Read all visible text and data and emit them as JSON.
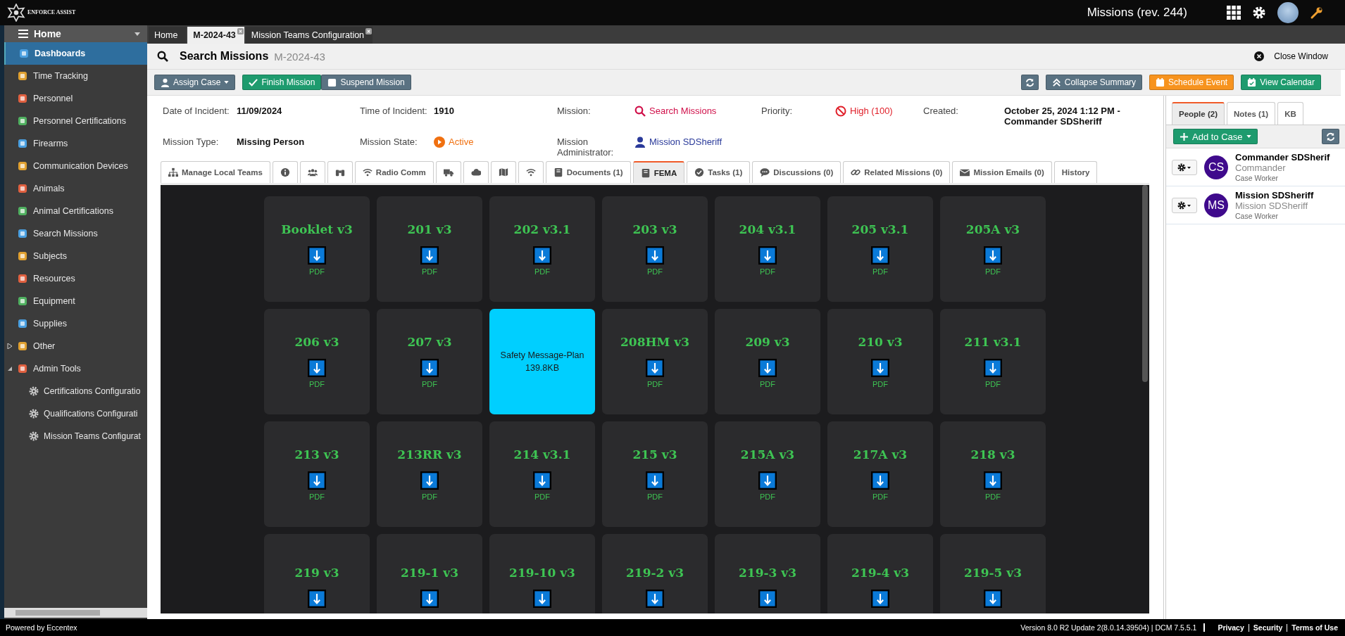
{
  "top_bar": {
    "logo_text": "ENFORCE ASSIST",
    "title": "Missions (rev. 244)"
  },
  "sidebar": {
    "header": "Home",
    "items": [
      {
        "label": "Dashboards",
        "selected": true
      },
      {
        "label": "Time Tracking",
        "selected": false
      },
      {
        "label": "Personnel",
        "selected": false
      },
      {
        "label": "Personnel Certifications",
        "selected": false
      },
      {
        "label": "Firearms",
        "selected": false
      },
      {
        "label": "Communication Devices",
        "selected": false
      },
      {
        "label": "Animals",
        "selected": false
      },
      {
        "label": "Animal Certifications",
        "selected": false
      },
      {
        "label": "Search Missions",
        "selected": false
      },
      {
        "label": "Subjects",
        "selected": false
      },
      {
        "label": "Resources",
        "selected": false
      },
      {
        "label": "Equipment",
        "selected": false
      },
      {
        "label": "Supplies",
        "selected": false
      },
      {
        "label": "Other",
        "selected": false,
        "expanded": false
      },
      {
        "label": "Admin Tools",
        "selected": false,
        "expanded": true,
        "children": [
          {
            "label": "Certifications Configuratio",
            "selected": false
          },
          {
            "label": "Qualifications Configurati",
            "selected": false
          },
          {
            "label": "Mission Teams Configurat",
            "selected": false
          }
        ]
      }
    ]
  },
  "doc_tabs": [
    {
      "label": "Home",
      "selected": false,
      "closable": false
    },
    {
      "label": "M-2024-43",
      "selected": true,
      "closable": true
    },
    {
      "label": "Mission Teams Configuration",
      "selected": false,
      "closable": true
    }
  ],
  "header": {
    "title": "Search Missions",
    "subtitle": "M-2024-43",
    "close": "Close Window"
  },
  "toolbar": {
    "left": [
      {
        "label": "Assign Case",
        "kind": "dropdown"
      },
      {
        "label": "Finish Mission",
        "kind": "finish"
      },
      {
        "label": "Suspend Mission",
        "kind": "suspend"
      }
    ],
    "right": [
      {
        "kind": "refresh"
      },
      {
        "label": "Collapse Summary",
        "kind": "collapse"
      },
      {
        "label": "Schedule Event",
        "kind": "schedule"
      },
      {
        "label": "View Calendar",
        "kind": "calendar"
      }
    ]
  },
  "summary": [
    {
      "label": "Date of Incident:",
      "value": "11/09/2024",
      "kind": "text"
    },
    {
      "label": "Time of Incident:",
      "value": "1910",
      "kind": "text"
    },
    {
      "label": "Mission:",
      "value": "Search Missions",
      "kind": "link"
    },
    {
      "label": "Priority:",
      "value": "High (100)",
      "kind": "priority"
    },
    {
      "label": "Created:",
      "value": "October 25, 2024 1:12 PM - Commander SDSheriff",
      "kind": "text"
    },
    {
      "label": "Mission Type:",
      "value": "Missing Person",
      "kind": "text"
    },
    {
      "label": "Mission State:",
      "value": "Active",
      "kind": "state"
    },
    {
      "label": "Mission Administrator:",
      "value": "Mission SDSheriff",
      "kind": "person"
    }
  ],
  "detail_tabs": [
    {
      "label": "Manage Local Teams",
      "selected": false
    },
    {
      "selected": false
    },
    {
      "selected": false
    },
    {
      "selected": false
    },
    {
      "label": "Radio Comm",
      "selected": false
    },
    {
      "selected": false
    },
    {
      "selected": false
    },
    {
      "selected": false
    },
    {
      "selected": false
    },
    {
      "label": "Documents (1)",
      "selected": false
    },
    {
      "label": "FEMA",
      "selected": true
    },
    {
      "label": "Tasks (1)",
      "selected": false
    },
    {
      "label": "Discussions (0)",
      "selected": false
    },
    {
      "label": "Related Missions (0)",
      "selected": false
    },
    {
      "label": "Mission Emails (0)",
      "selected": false
    },
    {
      "label": "History",
      "selected": false
    }
  ],
  "forms": [
    {
      "title": "Booklet v3",
      "file_type": "PDF",
      "kind": "pdf"
    },
    {
      "title": "201 v3",
      "file_type": "PDF",
      "kind": "pdf"
    },
    {
      "title": "202 v3.1",
      "file_type": "PDF",
      "kind": "pdf"
    },
    {
      "title": "203 v3",
      "file_type": "PDF",
      "kind": "pdf"
    },
    {
      "title": "204 v3.1",
      "file_type": "PDF",
      "kind": "pdf"
    },
    {
      "title": "205 v3.1",
      "file_type": "PDF",
      "kind": "pdf"
    },
    {
      "title": "205A v3",
      "file_type": "PDF",
      "kind": "pdf"
    },
    {
      "title": "206 v3",
      "file_type": "PDF",
      "kind": "pdf"
    },
    {
      "title": "207 v3",
      "file_type": "PDF",
      "kind": "pdf"
    },
    {
      "title": "Safety Message-Plan",
      "size": "139.8KB",
      "kind": "info"
    },
    {
      "title": "208HM v3",
      "file_type": "PDF",
      "kind": "pdf"
    },
    {
      "title": "209 v3",
      "file_type": "PDF",
      "kind": "pdf"
    },
    {
      "title": "210 v3",
      "file_type": "PDF",
      "kind": "pdf"
    },
    {
      "title": "211 v3.1",
      "file_type": "PDF",
      "kind": "pdf"
    },
    {
      "title": "213 v3",
      "file_type": "PDF",
      "kind": "pdf"
    },
    {
      "title": "213RR v3",
      "file_type": "PDF",
      "kind": "pdf"
    },
    {
      "title": "214 v3.1",
      "file_type": "PDF",
      "kind": "pdf"
    },
    {
      "title": "215 v3",
      "file_type": "PDF",
      "kind": "pdf"
    },
    {
      "title": "215A v3",
      "file_type": "PDF",
      "kind": "pdf"
    },
    {
      "title": "217A v3",
      "file_type": "PDF",
      "kind": "pdf"
    },
    {
      "title": "218 v3",
      "file_type": "PDF",
      "kind": "pdf"
    },
    {
      "title": "219 v3",
      "kind": "pdf"
    },
    {
      "title": "219-1 v3",
      "kind": "pdf"
    },
    {
      "title": "219-10 v3",
      "kind": "pdf"
    },
    {
      "title": "219-2 v3",
      "kind": "pdf"
    },
    {
      "title": "219-3 v3",
      "kind": "pdf"
    },
    {
      "title": "219-4 v3",
      "kind": "pdf"
    },
    {
      "title": "219-5 v3",
      "kind": "pdf"
    }
  ],
  "side_panel": {
    "tabs": [
      {
        "label": "People (2)",
        "selected": true
      },
      {
        "label": "Notes (1)",
        "selected": false
      },
      {
        "label": "KB",
        "selected": false
      }
    ],
    "add_button": "Add to Case",
    "people": [
      {
        "initials": "CS",
        "name": "Commander SDSherif",
        "title": "Commander",
        "role": "Case Worker"
      },
      {
        "initials": "MS",
        "name": "Mission SDSheriff",
        "title": "Mission SDSheriff",
        "role": "Case Worker"
      }
    ]
  },
  "footer": {
    "powered_by": "Powered by Eccentex",
    "version": "Version  8.0 R2 Update 2(8.0.14.39504) | DCM 7.5.5.1",
    "links": [
      "Privacy",
      "Security",
      "Terms of Use"
    ]
  }
}
